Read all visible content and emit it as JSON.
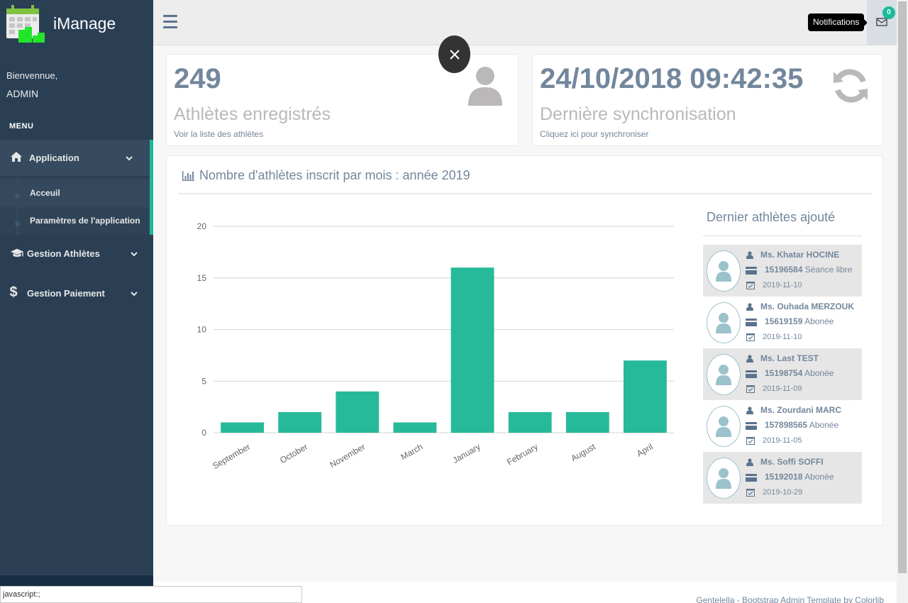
{
  "brand": {
    "name": "iManage"
  },
  "profile": {
    "welcome": "Bienvennue,",
    "username": "ADMIN"
  },
  "sidebar": {
    "menu_title": "MENU",
    "items": [
      {
        "label": "Application",
        "icon": "home-icon"
      },
      {
        "label": "Gestion Athlètes",
        "icon": "graduation-cap-icon"
      },
      {
        "label": "Gestion Paiement",
        "icon": "dollar-icon"
      }
    ],
    "submenu": [
      {
        "label": "Acceuil"
      },
      {
        "label": "Paramètres de l'application"
      }
    ]
  },
  "topnav": {
    "tooltip": "Notifications",
    "notification_count": "0"
  },
  "tiles": [
    {
      "count": "249",
      "title": "Athlètes enregistrés",
      "subtitle": "Voir la liste des athlètes",
      "icon": "user-icon"
    },
    {
      "count": "24/10/2018 09:42:35",
      "title": "Dernière synchronisation",
      "subtitle": "Cliquez ici pour synchroniser",
      "icon": "refresh-icon"
    }
  ],
  "panel": {
    "title": "Nombre d'athlètes inscrit par mois : année 2019"
  },
  "chart_data": {
    "type": "bar",
    "title": "Nombre d'athlètes inscrit par mois : année 2019",
    "categories": [
      "September",
      "October",
      "November",
      "March",
      "January",
      "February",
      "August",
      "April"
    ],
    "values": [
      1,
      2,
      4,
      1,
      16,
      2,
      2,
      7
    ],
    "ylim": [
      0,
      20
    ],
    "yticks": [
      0,
      5,
      10,
      15,
      20
    ],
    "grid": true,
    "color": "#26b99a"
  },
  "latest": {
    "title": "Dernier athlètes ajouté",
    "athletes": [
      {
        "name": "Ms. Khatar HOCINE",
        "id": "15196584",
        "plan": "Séance libre",
        "date": "2019-11-10"
      },
      {
        "name": "Ms. Ouhada MERZOUK",
        "id": "15619159",
        "plan": "Abonée",
        "date": "2019-11-10"
      },
      {
        "name": "Ms. Last TEST",
        "id": "15198754",
        "plan": "Abonée",
        "date": "2019-11-09"
      },
      {
        "name": "Ms. Zourdani MARC",
        "id": "157898565",
        "plan": "Abonée",
        "date": "2019-11-05"
      },
      {
        "name": "Ms. Soffi SOFFI",
        "id": "15192018",
        "plan": "Abonée",
        "date": "2019-10-29"
      }
    ]
  },
  "footer": {
    "text": "Gentelella - Bootstrap Admin Template by Colorlib"
  },
  "statusbar": {
    "text": "javascript:;"
  }
}
